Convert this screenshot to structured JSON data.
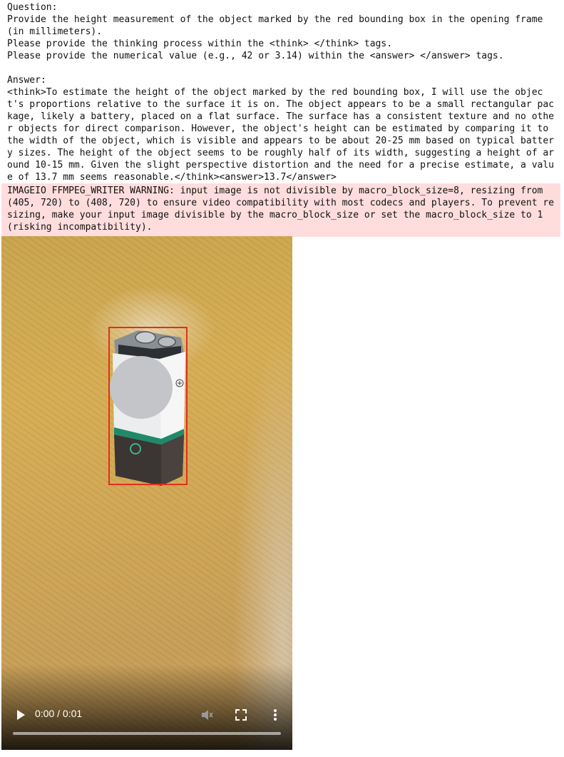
{
  "output_text": "Question:\nProvide the height measurement of the object marked by the red bounding box in the opening frame (in millimeters).\nPlease provide the thinking process within the <think> </think> tags.\nPlease provide the numerical value (e.g., 42 or 3.14) within the <answer> </answer> tags.\n\nAnswer:\n<think>To estimate the height of the object marked by the red bounding box, I will use the object's proportions relative to the surface it is on. The object appears to be a small rectangular package, likely a battery, placed on a flat surface. The surface has a consistent texture and no other objects for direct comparison. However, the object's height can be estimated by comparing it to the width of the object, which is visible and appears to be about 20-25 mm based on typical battery sizes. The height of the object seems to be roughly half of its width, suggesting a height of around 10-15 mm. Given the slight perspective distortion and the need for a precise estimate, a value of 13.7 mm seems reasonable.</think><answer>13.7</answer>",
  "warning_text": "IMAGEIO FFMPEG_WRITER WARNING: input image is not divisible by macro_block_size=8, resizing from (405, 720) to (408, 720) to ensure video compatibility with most codecs and players. To prevent resizing, make your input image divisible by the macro_block_size or set the macro_block_size to 1 (risking incompatibility).",
  "video": {
    "time_display": "0:00 / 0:01",
    "progress_fraction": 0.0,
    "icons": [
      "play-icon",
      "volume-muted-icon",
      "fullscreen-icon",
      "more-options-icon"
    ],
    "bbox_color": "#e0301e"
  }
}
